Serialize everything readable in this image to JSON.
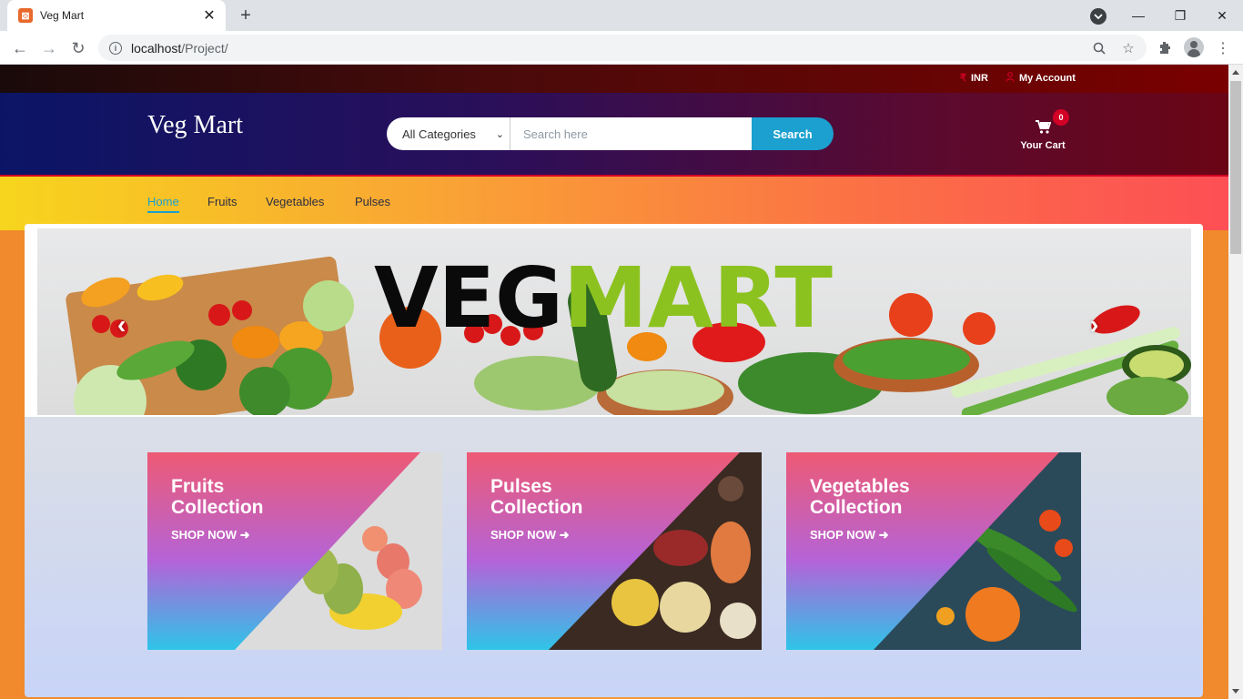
{
  "browser": {
    "tab_title": "Veg Mart",
    "url_host": "localhost",
    "url_path": "/Project/"
  },
  "topbar": {
    "currency": "INR",
    "account": "My Account"
  },
  "header": {
    "logo": "Veg Mart",
    "category_selected": "All Categories",
    "search_placeholder": "Search here",
    "search_button": "Search",
    "cart_count": "0",
    "cart_label": "Your Cart"
  },
  "nav": {
    "items": [
      "Home",
      "Fruits",
      "Vegetables",
      "Pulses"
    ],
    "active": "Home"
  },
  "hero": {
    "brand_left": "VEG",
    "brand_right": "MART"
  },
  "collections": [
    {
      "title_line1": "Fruits",
      "title_line2": "Collection",
      "link": "SHOP NOW"
    },
    {
      "title_line1": "Pulses",
      "title_line2": "Collection",
      "link": "SHOP NOW"
    },
    {
      "title_line1": "Vegetables",
      "title_line2": "Collection",
      "link": "SHOP NOW"
    }
  ],
  "colors": {
    "accent": "#d10024",
    "search_button": "#1ba0cf",
    "brand_green": "#8cc21f"
  }
}
